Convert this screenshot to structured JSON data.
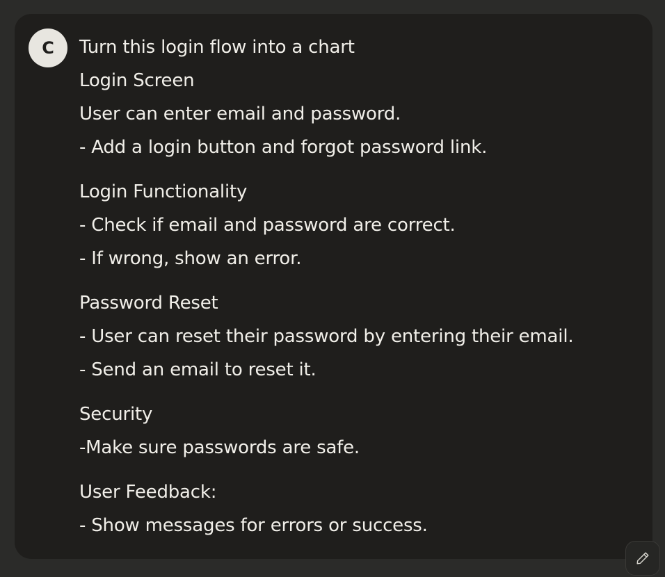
{
  "message": {
    "avatar_initial": "C",
    "lines": [
      "Turn this login flow into a chart",
      "Login Screen",
      "User can enter email and password.",
      "- Add a login button and forgot password link.",
      "Login Functionality",
      "- Check if email and password are correct.",
      "- If wrong, show an error.",
      "Password Reset",
      "- User can reset their password by entering their email.",
      "- Send an email to reset it.",
      "Security",
      "-Make sure passwords are safe.",
      "User Feedback:",
      "- Show messages for errors or success."
    ]
  },
  "actions": {
    "edit_icon": "pencil-icon"
  }
}
